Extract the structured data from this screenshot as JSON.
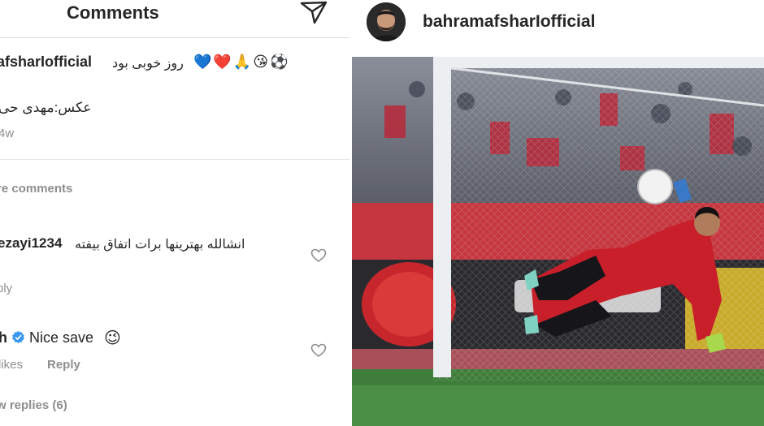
{
  "comments_panel": {
    "title": "Comments",
    "caption": {
      "username": "afsharIofficial",
      "text": "روز خوبی بود",
      "emojis": [
        "💙",
        "❤️",
        "🙏",
        "😘",
        "⚽"
      ],
      "photo_credit": "عکس:مهدی حی",
      "time": "4w"
    },
    "more_comments": "re comments",
    "comments": [
      {
        "username": "ezayi1234",
        "text": "انشالله بهترینها برات اتفاق بیفته",
        "reply": "ply"
      },
      {
        "username": "h",
        "text": "Nice save",
        "emoji": "😉",
        "likes": "likes",
        "reply": "Reply"
      }
    ],
    "view_replies": "w replies (6)"
  },
  "post": {
    "username": "bahramafsharIofficial"
  },
  "colors": {
    "text": "#262626",
    "secondary": "#8e8e8e",
    "verified": "#3897f0",
    "divider": "#dbdbdb"
  },
  "icons": [
    "send-icon",
    "heart-icon",
    "verified-badge-icon"
  ]
}
